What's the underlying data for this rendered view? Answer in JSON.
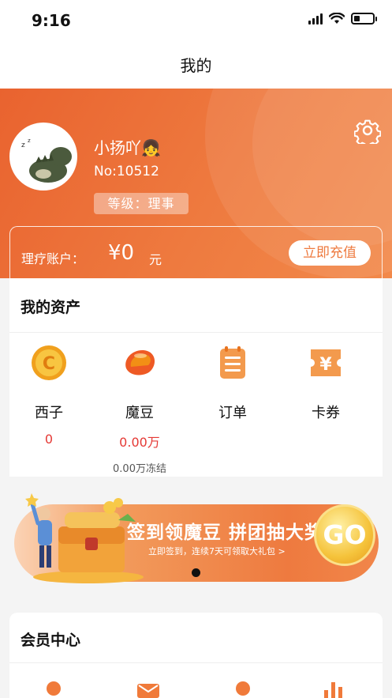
{
  "status": {
    "time": "9:16"
  },
  "nav": {
    "title": "我的"
  },
  "profile": {
    "username": "小扬吖👧",
    "number": "No:10512",
    "level": "等级：理事"
  },
  "account": {
    "label": "理疗账户：",
    "amount": "¥0",
    "unit": "元",
    "recharge_label": "立即充值"
  },
  "assets": {
    "title": "我的资产",
    "items": [
      {
        "label": "西子",
        "value": "0",
        "sub": "",
        "icon": "coin-c-icon"
      },
      {
        "label": "魔豆",
        "value": "0.00万",
        "sub": "0.00万冻结",
        "icon": "magic-bean-icon"
      },
      {
        "label": "订单",
        "value": "",
        "sub": "",
        "icon": "order-list-icon"
      },
      {
        "label": "卡券",
        "value": "",
        "sub": "",
        "icon": "coupon-yen-icon"
      }
    ]
  },
  "banner": {
    "title": "签到领魔豆  拼团抽大奖",
    "subtitle": "立即签到，连续7天可领取大礼包 >",
    "go_label": "GO"
  },
  "member": {
    "title": "会员中心"
  },
  "colors": {
    "accent": "#ee7a3f",
    "value_red": "#e53935"
  }
}
